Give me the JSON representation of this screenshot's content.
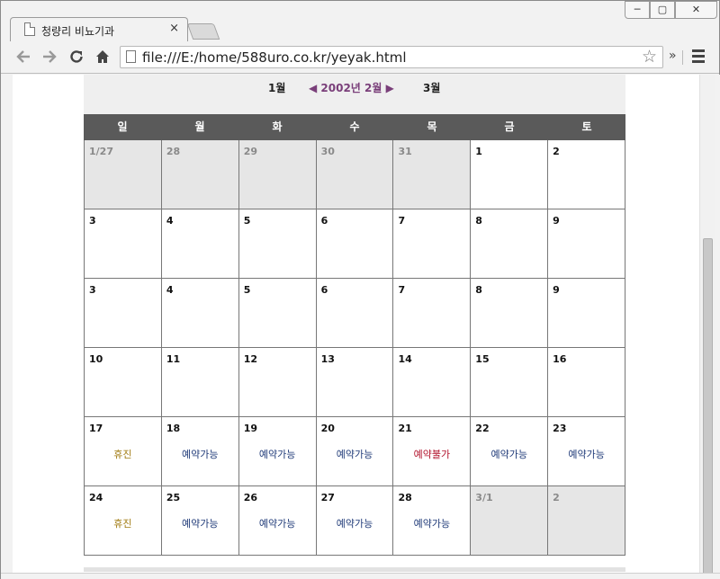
{
  "browser": {
    "tab_title": "청량리 비뇨기과",
    "tab_close": "×",
    "url": "file:///E:/home/588uro.co.kr/yeyak.html",
    "win_min": "─",
    "win_max": "▢",
    "win_close": "✕",
    "more": "»"
  },
  "calendar": {
    "prev_month": "1월",
    "current_month": "2002년 2월",
    "next_month": "3월",
    "weekdays": [
      "일",
      "월",
      "화",
      "수",
      "목",
      "금",
      "토"
    ],
    "rows": [
      [
        {
          "d": "1/27",
          "off": true,
          "s": ""
        },
        {
          "d": "28",
          "off": true,
          "s": ""
        },
        {
          "d": "29",
          "off": true,
          "s": ""
        },
        {
          "d": "30",
          "off": true,
          "s": ""
        },
        {
          "d": "31",
          "off": true,
          "s": ""
        },
        {
          "d": "1",
          "off": false,
          "s": ""
        },
        {
          "d": "2",
          "off": false,
          "s": ""
        }
      ],
      [
        {
          "d": "3",
          "off": false,
          "s": ""
        },
        {
          "d": "4",
          "off": false,
          "s": ""
        },
        {
          "d": "5",
          "off": false,
          "s": ""
        },
        {
          "d": "6",
          "off": false,
          "s": ""
        },
        {
          "d": "7",
          "off": false,
          "s": ""
        },
        {
          "d": "8",
          "off": false,
          "s": ""
        },
        {
          "d": "9",
          "off": false,
          "s": ""
        }
      ],
      [
        {
          "d": "3",
          "off": false,
          "s": ""
        },
        {
          "d": "4",
          "off": false,
          "s": ""
        },
        {
          "d": "5",
          "off": false,
          "s": ""
        },
        {
          "d": "6",
          "off": false,
          "s": ""
        },
        {
          "d": "7",
          "off": false,
          "s": ""
        },
        {
          "d": "8",
          "off": false,
          "s": ""
        },
        {
          "d": "9",
          "off": false,
          "s": ""
        }
      ],
      [
        {
          "d": "10",
          "off": false,
          "s": ""
        },
        {
          "d": "11",
          "off": false,
          "s": ""
        },
        {
          "d": "12",
          "off": false,
          "s": ""
        },
        {
          "d": "13",
          "off": false,
          "s": ""
        },
        {
          "d": "14",
          "off": false,
          "s": ""
        },
        {
          "d": "15",
          "off": false,
          "s": ""
        },
        {
          "d": "16",
          "off": false,
          "s": ""
        }
      ],
      [
        {
          "d": "17",
          "off": false,
          "s": "휴진",
          "k": "closed"
        },
        {
          "d": "18",
          "off": false,
          "s": "예약가능",
          "k": "avail"
        },
        {
          "d": "19",
          "off": false,
          "s": "예약가능",
          "k": "avail"
        },
        {
          "d": "20",
          "off": false,
          "s": "예약가능",
          "k": "avail"
        },
        {
          "d": "21",
          "off": false,
          "s": "예약불가",
          "k": "full"
        },
        {
          "d": "22",
          "off": false,
          "s": "예약가능",
          "k": "avail"
        },
        {
          "d": "23",
          "off": false,
          "s": "예약가능",
          "k": "avail"
        }
      ],
      [
        {
          "d": "24",
          "off": false,
          "s": "휴진",
          "k": "closed"
        },
        {
          "d": "25",
          "off": false,
          "s": "예약가능",
          "k": "avail"
        },
        {
          "d": "26",
          "off": false,
          "s": "예약가능",
          "k": "avail"
        },
        {
          "d": "27",
          "off": false,
          "s": "예약가능",
          "k": "avail"
        },
        {
          "d": "28",
          "off": false,
          "s": "예약가능",
          "k": "avail"
        },
        {
          "d": "3/1",
          "off": true,
          "s": ""
        },
        {
          "d": "2",
          "off": true,
          "s": ""
        }
      ]
    ]
  },
  "colors": {
    "month_accent": "#7a3f7a",
    "header_bg": "#5a5a5a",
    "available": "#1f3a78",
    "closed": "#a07a10",
    "unavailable": "#b0102a",
    "off_month_bg": "#e6e6e6"
  },
  "icons": {
    "back": "back-arrow-icon",
    "forward": "forward-arrow-icon",
    "reload": "reload-icon",
    "home": "home-icon",
    "star": "bookmark-star-icon",
    "menu": "hamburger-menu-icon",
    "page": "page-icon"
  }
}
